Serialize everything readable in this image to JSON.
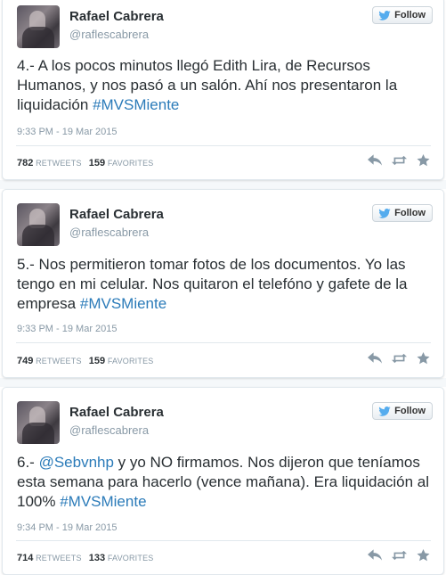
{
  "colors": {
    "link": "#2b7bb9",
    "muted": "#8899a6",
    "text": "#292f33"
  },
  "tweets": [
    {
      "name": "Rafael Cabrera",
      "handle": "@raflescabrera",
      "follow_label": "Follow",
      "text": "4.- A los pocos minutos llegó Edith Lira, de Recursos Humanos, y nos pasó a un salón. Ahí nos presentaron la liquidación ",
      "hashtag": "#MVSMiente",
      "time": "9:33 PM - 19 Mar 2015",
      "retweets": "782",
      "retweets_label": "RETWEETS",
      "favorites": "159",
      "favorites_label": "FAVORITES"
    },
    {
      "name": "Rafael Cabrera",
      "handle": "@raflescabrera",
      "follow_label": "Follow",
      "text": "5.- Nos permitieron tomar fotos de los documentos. Yo las tengo en mi celular. Nos quitaron el telefóno y gafete de la empresa ",
      "hashtag": "#MVSMiente",
      "time": "9:33 PM - 19 Mar 2015",
      "retweets": "749",
      "retweets_label": "RETWEETS",
      "favorites": "159",
      "favorites_label": "FAVORITES"
    },
    {
      "name": "Rafael Cabrera",
      "handle": "@raflescabrera",
      "follow_label": "Follow",
      "mention": "@Sebvnhp",
      "text": "6.- ",
      "text_after_mention": " y yo NO firmamos. Nos dijeron que teníamos esta semana para hacerlo (vence mañana). Era liquidación al 100% ",
      "hashtag": "#MVSMiente",
      "time": "9:34 PM - 19 Mar 2015",
      "retweets": "714",
      "retweets_label": "RETWEETS",
      "favorites": "133",
      "favorites_label": "FAVORITES"
    }
  ],
  "icons": {
    "reply": "reply-icon",
    "retweet": "retweet-icon",
    "favorite": "favorite-icon",
    "follow": "twitter-bird-icon"
  }
}
